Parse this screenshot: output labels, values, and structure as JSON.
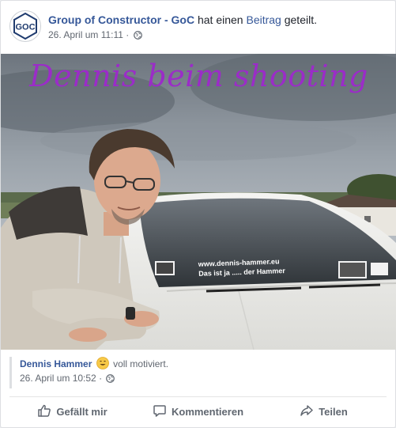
{
  "header": {
    "page_name": "Group of Constructor - GoC",
    "action_text": "hat einen",
    "post_link": "Beitrag",
    "action_suffix": "geteilt.",
    "timestamp": "26. April um 11:11",
    "separator": "·",
    "avatar_text": "GOC"
  },
  "photo": {
    "caption": "Dennis beim shooting",
    "car_line_1": "www.dennis-hammer.eu",
    "car_line_2": "Das ist ja .....   der Hammer"
  },
  "shared": {
    "name": "Dennis Hammer",
    "feeling": "voll motiviert.",
    "timestamp": "26. April um 10:52",
    "separator": "·"
  },
  "actions": {
    "like": "Gefällt mir",
    "comment": "Kommentieren",
    "share": "Teilen"
  },
  "icons": {
    "privacy": "globe-icon",
    "like": "thumbs-up-icon",
    "comment": "comment-icon",
    "share": "share-icon",
    "feeling": "smiley-emoji-icon"
  },
  "colors": {
    "link": "#365899",
    "meta": "#616770",
    "caption": "#9b2cc8"
  }
}
